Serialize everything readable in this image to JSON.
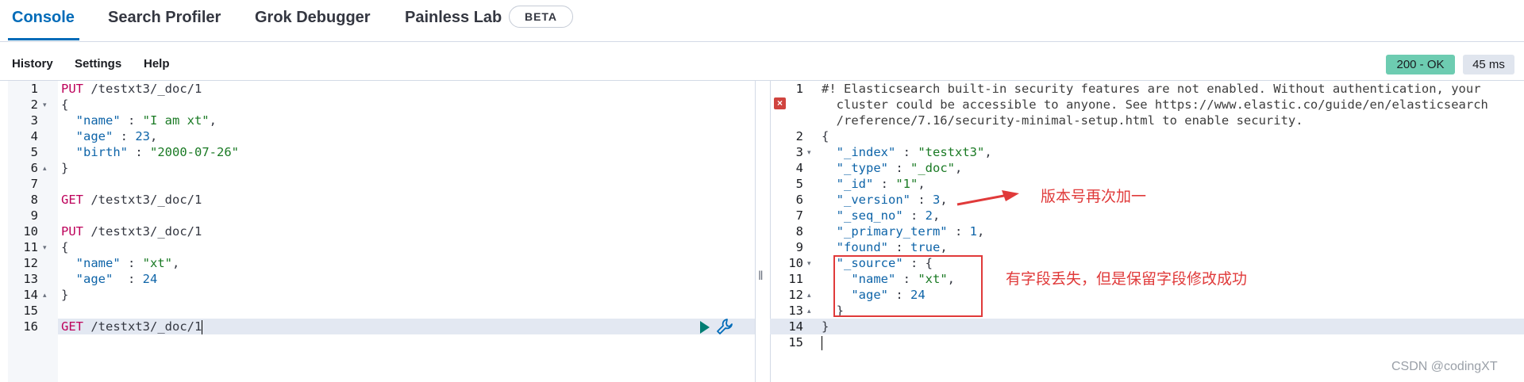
{
  "tabs": [
    {
      "label": "Console",
      "active": true
    },
    {
      "label": "Search Profiler",
      "active": false
    },
    {
      "label": "Grok Debugger",
      "active": false
    },
    {
      "label": "Painless Lab",
      "active": false
    }
  ],
  "beta_badge": "BETA",
  "toolbar": {
    "history": "History",
    "settings": "Settings",
    "help": "Help"
  },
  "status": {
    "code": "200 - OK",
    "time": "45 ms"
  },
  "colors": {
    "accent": "#006bb8",
    "status_ok": "#6dccb1",
    "annotation": "#e03a3a"
  },
  "request_editor": {
    "line_numbers": [
      "1",
      "2",
      "3",
      "4",
      "5",
      "6",
      "7",
      "8",
      "9",
      "10",
      "11",
      "12",
      "13",
      "14",
      "15",
      "16"
    ],
    "lines": [
      [
        {
          "t": "PUT",
          "c": "k-method"
        },
        {
          "t": " /testxt3/_doc/1",
          "c": "k-url"
        }
      ],
      [
        {
          "t": "{",
          "c": "k-punc"
        }
      ],
      [
        {
          "t": "  \"name\"",
          "c": "k-key"
        },
        {
          "t": " : ",
          "c": "k-punc"
        },
        {
          "t": "\"I am xt\"",
          "c": "k-str"
        },
        {
          "t": ",",
          "c": "k-punc"
        }
      ],
      [
        {
          "t": "  \"age\"",
          "c": "k-key"
        },
        {
          "t": " : ",
          "c": "k-punc"
        },
        {
          "t": "23",
          "c": "k-num"
        },
        {
          "t": ",",
          "c": "k-punc"
        }
      ],
      [
        {
          "t": "  \"birth\"",
          "c": "k-key"
        },
        {
          "t": " : ",
          "c": "k-punc"
        },
        {
          "t": "\"2000-07-26\"",
          "c": "k-str"
        }
      ],
      [
        {
          "t": "}",
          "c": "k-punc"
        }
      ],
      [],
      [
        {
          "t": "GET",
          "c": "k-method"
        },
        {
          "t": " /testxt3/_doc/1",
          "c": "k-url"
        }
      ],
      [],
      [
        {
          "t": "PUT",
          "c": "k-method"
        },
        {
          "t": " /testxt3/_doc/1",
          "c": "k-url"
        }
      ],
      [
        {
          "t": "{",
          "c": "k-punc"
        }
      ],
      [
        {
          "t": "  \"name\"",
          "c": "k-key"
        },
        {
          "t": " : ",
          "c": "k-punc"
        },
        {
          "t": "\"xt\"",
          "c": "k-str"
        },
        {
          "t": ",",
          "c": "k-punc"
        }
      ],
      [
        {
          "t": "  \"age\"",
          "c": "k-key"
        },
        {
          "t": "  : ",
          "c": "k-punc"
        },
        {
          "t": "24",
          "c": "k-num"
        }
      ],
      [
        {
          "t": "}",
          "c": "k-punc"
        }
      ],
      [],
      [
        {
          "t": "GET",
          "c": "k-method"
        },
        {
          "t": " /testxt3/_doc/1",
          "c": "k-url"
        }
      ]
    ],
    "fold_markers": {
      "2": "▾",
      "6": "▴",
      "11": "▾",
      "14": "▴"
    },
    "active_line": 16
  },
  "response_editor": {
    "line_numbers": [
      "1",
      "",
      "",
      "2",
      "3",
      "4",
      "5",
      "6",
      "7",
      "8",
      "9",
      "10",
      "11",
      "12",
      "13",
      "14",
      "15"
    ],
    "lines": [
      [
        {
          "t": "#! Elasticsearch built-in security features are not enabled. Without authentication, your",
          "c": "k-comment"
        }
      ],
      [
        {
          "t": "  cluster could be accessible to anyone. See https://www.elastic.co/guide/en/elasticsearch",
          "c": "k-comment"
        }
      ],
      [
        {
          "t": "  /reference/7.16/security-minimal-setup.html to enable security.",
          "c": "k-comment"
        }
      ],
      [
        {
          "t": "{",
          "c": "k-punc"
        }
      ],
      [
        {
          "t": "  \"_index\"",
          "c": "k-key"
        },
        {
          "t": " : ",
          "c": "k-punc"
        },
        {
          "t": "\"testxt3\"",
          "c": "k-str"
        },
        {
          "t": ",",
          "c": "k-punc"
        }
      ],
      [
        {
          "t": "  \"_type\"",
          "c": "k-key"
        },
        {
          "t": " : ",
          "c": "k-punc"
        },
        {
          "t": "\"_doc\"",
          "c": "k-str"
        },
        {
          "t": ",",
          "c": "k-punc"
        }
      ],
      [
        {
          "t": "  \"_id\"",
          "c": "k-key"
        },
        {
          "t": " : ",
          "c": "k-punc"
        },
        {
          "t": "\"1\"",
          "c": "k-str"
        },
        {
          "t": ",",
          "c": "k-punc"
        }
      ],
      [
        {
          "t": "  \"_version\"",
          "c": "k-key"
        },
        {
          "t": " : ",
          "c": "k-punc"
        },
        {
          "t": "3",
          "c": "k-num"
        },
        {
          "t": ",",
          "c": "k-punc"
        }
      ],
      [
        {
          "t": "  \"_seq_no\"",
          "c": "k-key"
        },
        {
          "t": " : ",
          "c": "k-punc"
        },
        {
          "t": "2",
          "c": "k-num"
        },
        {
          "t": ",",
          "c": "k-punc"
        }
      ],
      [
        {
          "t": "  \"_primary_term\"",
          "c": "k-key"
        },
        {
          "t": " : ",
          "c": "k-punc"
        },
        {
          "t": "1",
          "c": "k-num"
        },
        {
          "t": ",",
          "c": "k-punc"
        }
      ],
      [
        {
          "t": "  \"found\"",
          "c": "k-key"
        },
        {
          "t": " : ",
          "c": "k-punc"
        },
        {
          "t": "true",
          "c": "k-bool"
        },
        {
          "t": ",",
          "c": "k-punc"
        }
      ],
      [
        {
          "t": "  \"_source\"",
          "c": "k-key"
        },
        {
          "t": " : {",
          "c": "k-punc"
        }
      ],
      [
        {
          "t": "    \"name\"",
          "c": "k-key"
        },
        {
          "t": " : ",
          "c": "k-punc"
        },
        {
          "t": "\"xt\"",
          "c": "k-str"
        },
        {
          "t": ",",
          "c": "k-punc"
        }
      ],
      [
        {
          "t": "    \"age\"",
          "c": "k-key"
        },
        {
          "t": " : ",
          "c": "k-punc"
        },
        {
          "t": "24",
          "c": "k-num"
        }
      ],
      [
        {
          "t": "  }",
          "c": "k-punc"
        }
      ],
      [
        {
          "t": "}",
          "c": "k-punc"
        }
      ],
      []
    ],
    "fold_markers": {
      "3": "▾",
      "10": "▾",
      "12": "▴",
      "13": "▴"
    },
    "active_line": 16
  },
  "annotations": {
    "version_note": "版本号再次加一",
    "source_note": "有字段丢失，但是保留字段修改成功"
  },
  "watermark": "CSDN @codingXT"
}
